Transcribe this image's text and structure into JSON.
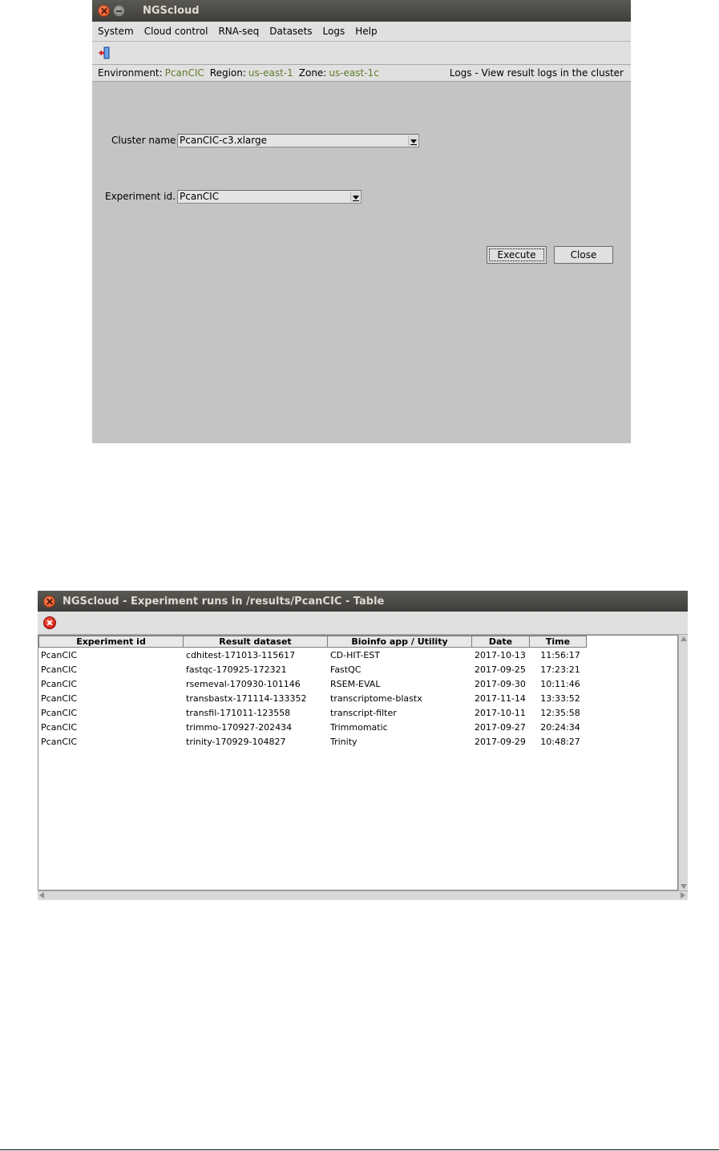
{
  "window1": {
    "title": "NGScloud",
    "menu": [
      "System",
      "Cloud control",
      "RNA-seq",
      "Datasets",
      "Logs",
      "Help"
    ],
    "toolbar": {
      "icon": "exit-icon"
    },
    "status": {
      "environment_label": "Environment:",
      "environment_value": "PcanCIC",
      "region_label": "Region:",
      "region_value": "us-east-1",
      "zone_label": "Zone:",
      "zone_value": "us-east-1c",
      "right_text": "Logs - View result logs in the cluster"
    },
    "form": {
      "cluster_label": "Cluster name",
      "cluster_value": "PcanCIC-c3.xlarge",
      "experiment_label": "Experiment id.",
      "experiment_value": "PcanCIC",
      "execute_label": "Execute",
      "close_label": "Close"
    }
  },
  "window2": {
    "title": "NGScloud - Experiment runs in /results/PcanCIC - Table",
    "toolbar": {
      "icon": "close-circle-icon"
    },
    "columns": [
      "Experiment id",
      "Result dataset",
      "Bioinfo app / Utility",
      "Date",
      "Time"
    ],
    "rows": [
      [
        "PcanCIC",
        "cdhitest-171013-115617",
        "CD-HIT-EST",
        "2017-10-13",
        "11:56:17"
      ],
      [
        "PcanCIC",
        "fastqc-170925-172321",
        "FastQC",
        "2017-09-25",
        "17:23:21"
      ],
      [
        "PcanCIC",
        "rsemeval-170930-101146",
        "RSEM-EVAL",
        "2017-09-30",
        "10:11:46"
      ],
      [
        "PcanCIC",
        "transbastx-171114-133352",
        "transcriptome-blastx",
        "2017-11-14",
        "13:33:52"
      ],
      [
        "PcanCIC",
        "transfil-171011-123558",
        "transcript-filter",
        "2017-10-11",
        "12:35:58"
      ],
      [
        "PcanCIC",
        "trimmo-170927-202434",
        "Trimmomatic",
        "2017-09-27",
        "20:24:34"
      ],
      [
        "PcanCIC",
        "trinity-170929-104827",
        "Trinity",
        "2017-09-29",
        "10:48:27"
      ]
    ]
  }
}
